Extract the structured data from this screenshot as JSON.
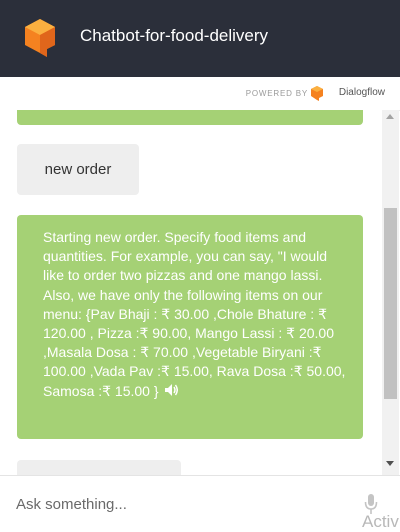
{
  "header": {
    "title": "Chatbot-for-food-delivery",
    "logo_icon": "dialogflow-agent-logo",
    "logo_color": "#f58220",
    "background": "#2b2f3a"
  },
  "powered": {
    "text": "POWERED BY",
    "brand": "Dialogflow",
    "brand_icon": "dialogflow-icon"
  },
  "chat": {
    "user_message": "new order",
    "bot_message": "Starting new order. Specify food items and quantities. For example, you can say, \"I would like to order two pizzas and one mango lassi. Also, we have only the following items on our menu: {Pav Bhaji : ₹ 30.00 ,Chole Bhature : ₹ 120.00 , Pizza :₹ 90.00, Mango Lassi : ₹ 20.00 ,Masala Dosa : ₹ 70.00 ,Vegetable Biryani :₹ 100.00 ,Vada Pav :₹ 15.00, Rava Dosa :₹ 50.00, Samosa :₹ 15.00 }",
    "bot_color": "#a5d175",
    "user_color": "#eeeeee"
  },
  "input": {
    "placeholder": "Ask something...",
    "mic_icon": "microphone-icon"
  },
  "watermark": "Activ"
}
